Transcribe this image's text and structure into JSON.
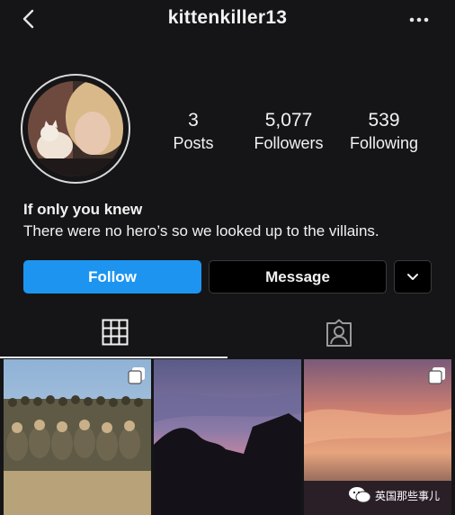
{
  "header": {
    "username": "kittenkiller13",
    "back_icon": "chevron-left-icon",
    "more_icon": "more-horizontal-icon"
  },
  "stats": {
    "posts": {
      "value": "3",
      "label": "Posts"
    },
    "followers": {
      "value": "5,077",
      "label": "Followers"
    },
    "following": {
      "value": "539",
      "label": "Following"
    }
  },
  "bio": {
    "name": "If only you knew",
    "text": "There were no hero’s so we looked up to the villains."
  },
  "actions": {
    "follow_label": "Follow",
    "message_label": "Message",
    "dropdown_icon": "chevron-down-icon"
  },
  "tabs": [
    {
      "icon": "grid-icon",
      "active": true
    },
    {
      "icon": "tagged-person-icon",
      "active": false
    }
  ],
  "posts": [
    {
      "icon": "multi-photo-icon",
      "multiple": true
    },
    {
      "multiple": false
    },
    {
      "icon": "multi-photo-icon",
      "multiple": true
    }
  ],
  "watermark": {
    "text": "英国那些事儿"
  },
  "colors": {
    "background": "#151517",
    "follow_button": "#1d95f0",
    "text": "#f2f2f2"
  }
}
